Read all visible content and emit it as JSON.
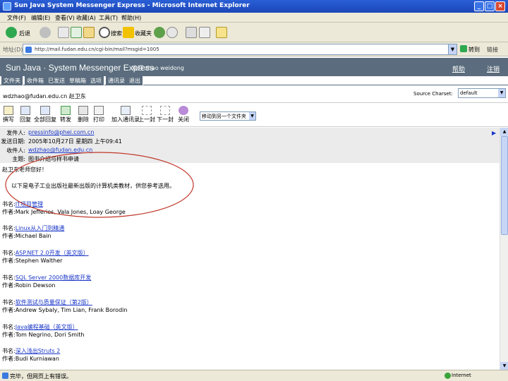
{
  "window": {
    "title": "Sun Java System Messenger Express - Microsoft Internet Explorer"
  },
  "menu": [
    "文件(F)",
    "编辑(E)",
    "查看(V)",
    "收藏(A)",
    "工具(T)",
    "帮助(H)"
  ],
  "toolbar": {
    "back_label": "后退",
    "search_label": "搜索",
    "favorites_label": "收藏夹"
  },
  "address": {
    "label": "地址(D)",
    "url": "http://mail.fudan.edu.cn/cgi-bin/mail?msgid=1005",
    "go_label": "转到",
    "links_label": "链接"
  },
  "app": {
    "title": "Sun Java · System Messenger Express",
    "user": "欢迎 zhao weidong",
    "header_links": [
      "帮助",
      "注销"
    ]
  },
  "tabs": [
    "文件夹",
    "收件箱",
    "已发送",
    "草稿箱",
    "选项",
    "通讯录",
    "退出"
  ],
  "account": {
    "email": "wdzhao@fudan.edu.cn 赵卫东",
    "charset_label": "Source Charset:",
    "charset_value": "default"
  },
  "actions": [
    {
      "icon": "new-message-icon",
      "label": "撰写"
    },
    {
      "icon": "reply-icon",
      "label": "回复"
    },
    {
      "icon": "reply-all-icon",
      "label": "全部回复"
    },
    {
      "icon": "forward-icon",
      "label": "转发"
    },
    {
      "icon": "delete-icon",
      "label": "删除"
    },
    {
      "icon": "print-icon",
      "label": "打印"
    },
    {
      "icon": "add-sender-icon",
      "label": "加入通讯录"
    },
    {
      "icon": "previous-icon",
      "label": "上一封"
    },
    {
      "icon": "next-icon",
      "label": "下一封"
    },
    {
      "icon": "close-icon",
      "label": "关闭"
    }
  ],
  "folder_select": "移动到另一个文件夹",
  "headers": {
    "from_label": "发件人:",
    "from": "pressinfo@phei.com.cn",
    "date_label": "发送日期:",
    "date": "2005年10月27日 星期四 上午09:41",
    "to_label": "收件人:",
    "to": "wdzhao@fudan.edu.cn",
    "subject_label": "主题:",
    "subject": "图书介绍与样书申请"
  },
  "body": {
    "greeting": "赵卫东老师您好！",
    "intro": "以下是电子工业出版社最新出版的计算机类教材，供您参考选用。",
    "books": [
      {
        "title_label": "书名:",
        "title": "IT项目管理",
        "author_label": "作者:",
        "author": "Mark Jefferies, Vala Jones, Loay George"
      },
      {
        "title_label": "书名:",
        "title": "Linux从入门到精通",
        "author_label": "作者:",
        "author": "Michael Bain"
      },
      {
        "title_label": "书名:",
        "title": "ASP.NET 2.0开发（英文版）",
        "author_label": "作者:",
        "author": "Stephen Walther"
      },
      {
        "title_label": "书名:",
        "title": "SQL Server 2000数据库开发",
        "author_label": "作者:",
        "author": "Robin Dewson"
      },
      {
        "title_label": "书名:",
        "title": "软件测试与质量保证（第2版）",
        "author_label": "作者:",
        "author": "Andrew Sybaly, Tim Lian, Frank Borodin"
      },
      {
        "title_label": "书名:",
        "title": "Java编程基础（英文版）",
        "author_label": "作者:",
        "author": "Tom Negrino, Dori Smith"
      },
      {
        "title_label": "书名:",
        "title": "深入浅出Struts 2",
        "author_label": "作者:",
        "author": "Budi Kurniawan"
      }
    ]
  },
  "status": {
    "text": "完毕，但网页上有错误。",
    "zone": "Internet"
  }
}
